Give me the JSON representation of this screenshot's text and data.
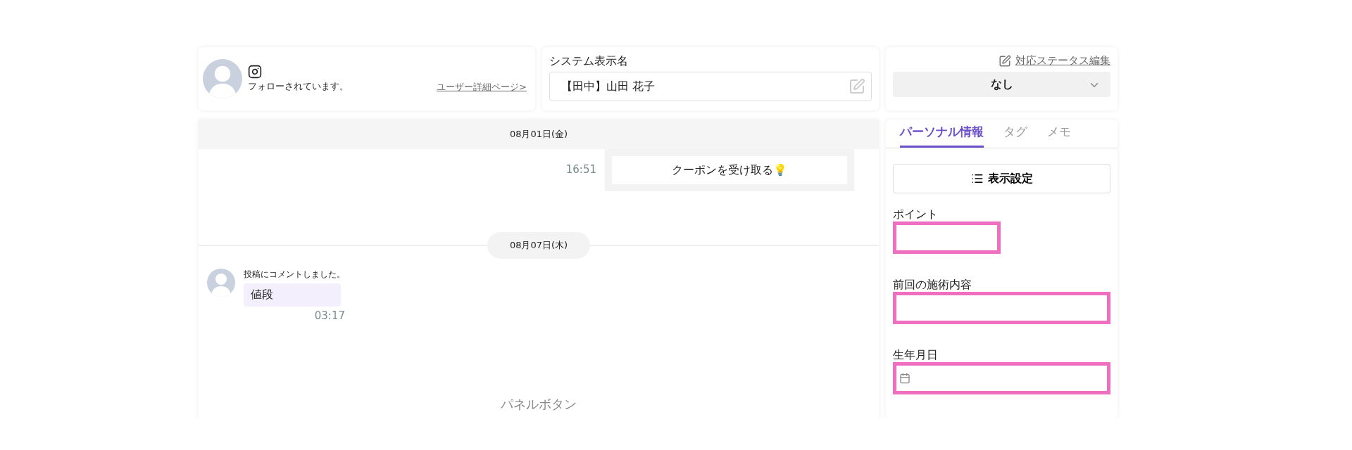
{
  "profile_card": {
    "follow_status": "フォローされています。",
    "detail_link": "ユーザー詳細ページ>"
  },
  "display_name_card": {
    "label": "システム表示名",
    "value": "【田中】山田 花子"
  },
  "status_card": {
    "edit_link": "対応ステータス編集",
    "status": "なし"
  },
  "chat": {
    "header_date": "08月01日(金)",
    "messages": [
      {
        "kind": "outgoing",
        "text": "クーポンを受け取る💡",
        "time": "16:51"
      },
      {
        "kind": "date",
        "text": "08月07日(木)"
      },
      {
        "kind": "incoming",
        "note": "投稿にコメントしました。",
        "text": "値段",
        "time": "03:17"
      }
    ],
    "panel_button": "パネルボタン"
  },
  "side_panel": {
    "tabs": [
      {
        "label": "パーソナル情報",
        "selected": true
      },
      {
        "label": "タグ",
        "selected": false
      },
      {
        "label": "メモ",
        "selected": false
      }
    ],
    "settings_button": "表示設定",
    "fields": [
      {
        "kind": "short",
        "label": "ポイント"
      },
      {
        "kind": "text",
        "label": "前回の施術内容"
      },
      {
        "kind": "date",
        "label": "生年月日"
      }
    ]
  }
}
